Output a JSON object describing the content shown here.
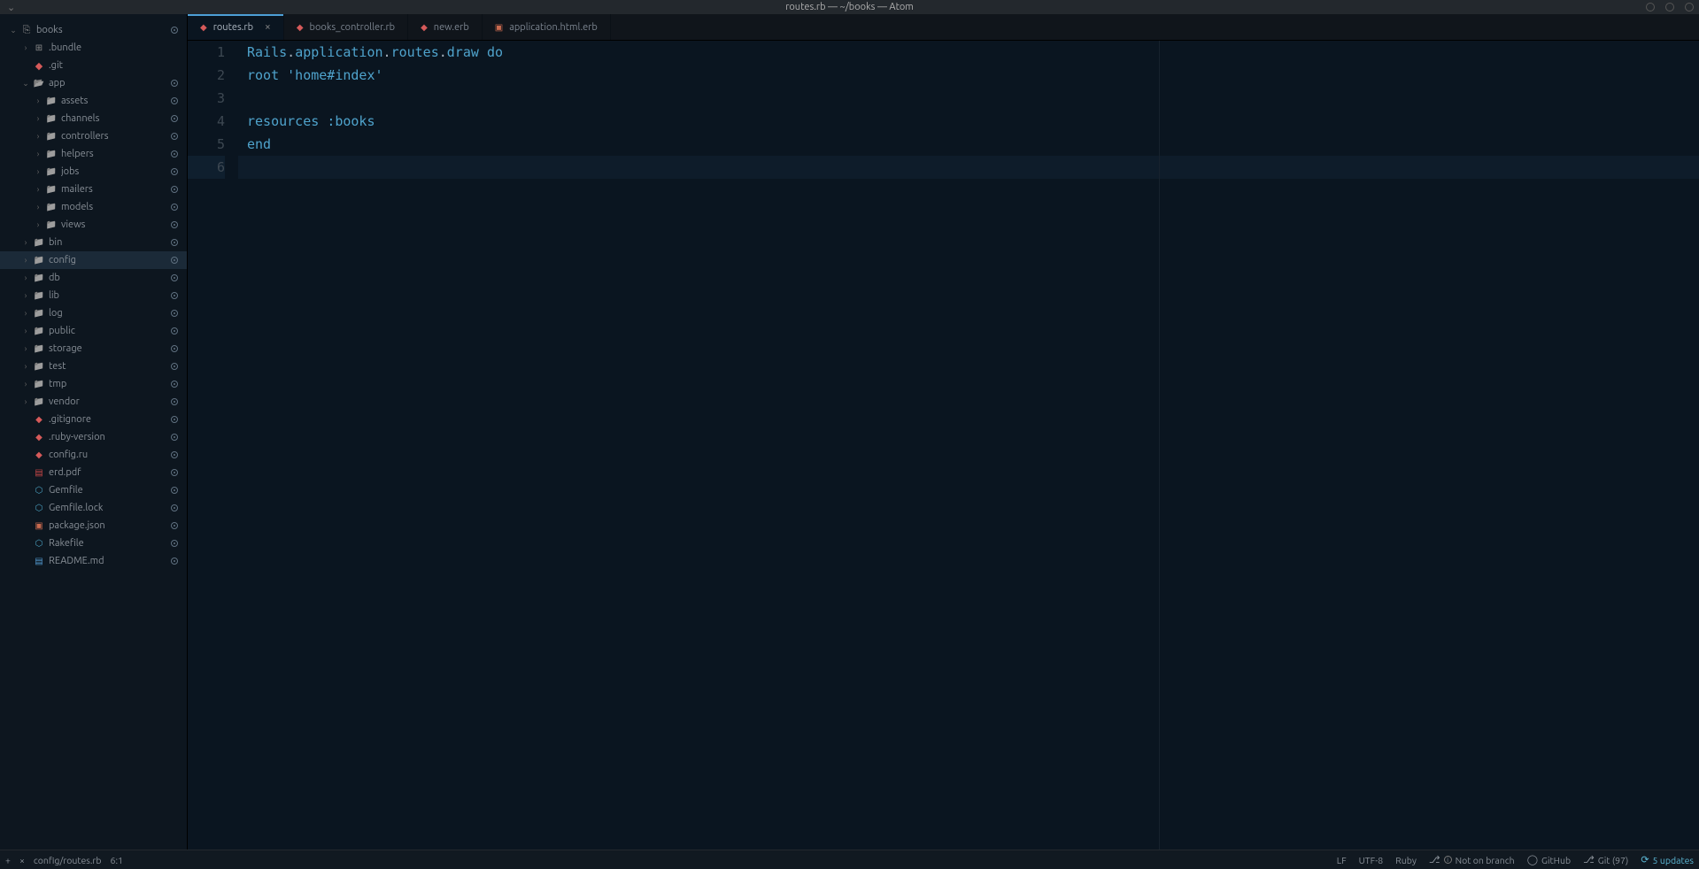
{
  "window": {
    "title": "routes.rb — ~/books — Atom"
  },
  "tree": {
    "root": "books",
    "items": [
      {
        "depth": 0,
        "disclosure": "v",
        "icon": "repo",
        "label": "books",
        "status": true,
        "cls": ""
      },
      {
        "depth": 1,
        "disclosure": ">",
        "icon": "bundle",
        "label": ".bundle",
        "status": false,
        "cls": ""
      },
      {
        "depth": 1,
        "disclosure": "",
        "icon": "git",
        "label": ".git",
        "status": false,
        "cls": ""
      },
      {
        "depth": 1,
        "disclosure": "v",
        "icon": "folder-open",
        "label": "app",
        "status": true,
        "cls": ""
      },
      {
        "depth": 2,
        "disclosure": ">",
        "icon": "folder",
        "label": "assets",
        "status": true,
        "cls": ""
      },
      {
        "depth": 2,
        "disclosure": ">",
        "icon": "folder",
        "label": "channels",
        "status": true,
        "cls": ""
      },
      {
        "depth": 2,
        "disclosure": ">",
        "icon": "folder",
        "label": "controllers",
        "status": true,
        "cls": ""
      },
      {
        "depth": 2,
        "disclosure": ">",
        "icon": "folder",
        "label": "helpers",
        "status": true,
        "cls": ""
      },
      {
        "depth": 2,
        "disclosure": ">",
        "icon": "folder",
        "label": "jobs",
        "status": true,
        "cls": ""
      },
      {
        "depth": 2,
        "disclosure": ">",
        "icon": "folder",
        "label": "mailers",
        "status": true,
        "cls": ""
      },
      {
        "depth": 2,
        "disclosure": ">",
        "icon": "folder",
        "label": "models",
        "status": true,
        "cls": ""
      },
      {
        "depth": 2,
        "disclosure": ">",
        "icon": "folder",
        "label": "views",
        "status": true,
        "cls": ""
      },
      {
        "depth": 1,
        "disclosure": ">",
        "icon": "folder",
        "label": "bin",
        "status": true,
        "cls": ""
      },
      {
        "depth": 1,
        "disclosure": ">",
        "icon": "folder",
        "label": "config",
        "status": true,
        "cls": "selected"
      },
      {
        "depth": 1,
        "disclosure": ">",
        "icon": "folder",
        "label": "db",
        "status": true,
        "cls": ""
      },
      {
        "depth": 1,
        "disclosure": ">",
        "icon": "folder",
        "label": "lib",
        "status": true,
        "cls": ""
      },
      {
        "depth": 1,
        "disclosure": ">",
        "icon": "folder",
        "label": "log",
        "status": true,
        "cls": ""
      },
      {
        "depth": 1,
        "disclosure": ">",
        "icon": "folder",
        "label": "public",
        "status": true,
        "cls": ""
      },
      {
        "depth": 1,
        "disclosure": ">",
        "icon": "folder",
        "label": "storage",
        "status": true,
        "cls": ""
      },
      {
        "depth": 1,
        "disclosure": ">",
        "icon": "folder",
        "label": "test",
        "status": true,
        "cls": ""
      },
      {
        "depth": 1,
        "disclosure": ">",
        "icon": "folder",
        "label": "tmp",
        "status": true,
        "cls": ""
      },
      {
        "depth": 1,
        "disclosure": ">",
        "icon": "folder",
        "label": "vendor",
        "status": true,
        "cls": ""
      },
      {
        "depth": 1,
        "disclosure": "",
        "icon": "ruby",
        "label": ".gitignore",
        "status": true,
        "cls": ""
      },
      {
        "depth": 1,
        "disclosure": "",
        "icon": "ruby",
        "label": ".ruby-version",
        "status": true,
        "cls": ""
      },
      {
        "depth": 1,
        "disclosure": "",
        "icon": "ruby",
        "label": "config.ru",
        "status": true,
        "cls": ""
      },
      {
        "depth": 1,
        "disclosure": "",
        "icon": "pdf",
        "label": "erd.pdf",
        "status": true,
        "cls": ""
      },
      {
        "depth": 1,
        "disclosure": "",
        "icon": "gem",
        "label": "Gemfile",
        "status": true,
        "cls": ""
      },
      {
        "depth": 1,
        "disclosure": "",
        "icon": "gem",
        "label": "Gemfile.lock",
        "status": true,
        "cls": ""
      },
      {
        "depth": 1,
        "disclosure": "",
        "icon": "json",
        "label": "package.json",
        "status": true,
        "cls": ""
      },
      {
        "depth": 1,
        "disclosure": "",
        "icon": "gem",
        "label": "Rakefile",
        "status": true,
        "cls": ""
      },
      {
        "depth": 1,
        "disclosure": "",
        "icon": "md",
        "label": "README.md",
        "status": true,
        "cls": ""
      }
    ]
  },
  "tabs": [
    {
      "label": "routes.rb",
      "icon": "ruby",
      "active": true,
      "close": true
    },
    {
      "label": "books_controller.rb",
      "icon": "ruby",
      "active": false,
      "close": false
    },
    {
      "label": "new.erb",
      "icon": "ruby",
      "active": false,
      "close": false
    },
    {
      "label": "application.html.erb",
      "icon": "html",
      "active": false,
      "close": false
    }
  ],
  "editor": {
    "line_numbers": [
      "1",
      "2",
      "3",
      "4",
      "5",
      "6"
    ],
    "current_line": 6,
    "lines_html": [
      "<span class='tok-const'>Rails</span><span class='tok-punct'>.</span><span class='tok-method'>application</span><span class='tok-punct'>.</span><span class='tok-method'>routes</span><span class='tok-punct'>.</span><span class='tok-method'>draw</span> <span class='tok-kw'>do</span>",
      "  <span class='tok-method'>root</span> <span class='tok-str'>'home#index'</span>",
      "",
      "  <span class='tok-method'>resources</span> <span class='tok-sym'>:books</span>",
      "<span class='tok-kw'>end</span>",
      ""
    ]
  },
  "statusbar": {
    "path": "config/routes.rb",
    "cursor": "6:1",
    "line_ending": "LF",
    "encoding": "UTF-8",
    "language": "Ruby",
    "branch": "Not on branch",
    "github": "GitHub",
    "git": "Git (97)",
    "updates": "5 updates"
  }
}
